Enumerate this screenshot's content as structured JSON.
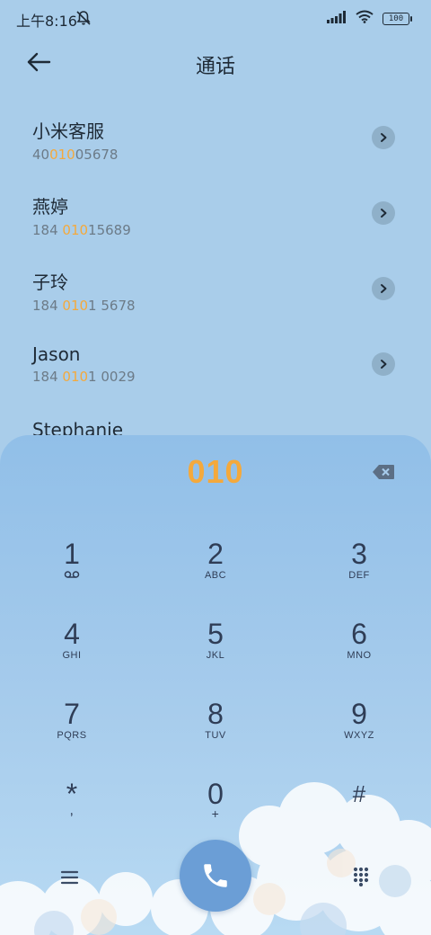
{
  "status": {
    "time": "上午8:16",
    "battery": "100"
  },
  "header": {
    "title": "通话"
  },
  "contacts": [
    {
      "name": "小米客服",
      "num_pre": "40",
      "num_hl": "010",
      "num_post": "05678"
    },
    {
      "name": "燕婷",
      "num_pre": "184 ",
      "num_hl": "010",
      "num_post": "15689"
    },
    {
      "name": "子玲",
      "num_pre": "184 ",
      "num_hl": "010",
      "num_post": "1 5678"
    },
    {
      "name": "Jason",
      "num_pre": "184 ",
      "num_hl": "010",
      "num_post": "1 0029"
    },
    {
      "name": "Stephanie",
      "num_pre": "",
      "num_hl": "",
      "num_post": ""
    }
  ],
  "dialer": {
    "input": "010",
    "keys": [
      {
        "digit": "1",
        "letters": ""
      },
      {
        "digit": "2",
        "letters": "ABC"
      },
      {
        "digit": "3",
        "letters": "DEF"
      },
      {
        "digit": "4",
        "letters": "GHI"
      },
      {
        "digit": "5",
        "letters": "JKL"
      },
      {
        "digit": "6",
        "letters": "MNO"
      },
      {
        "digit": "7",
        "letters": "PQRS"
      },
      {
        "digit": "8",
        "letters": "TUV"
      },
      {
        "digit": "9",
        "letters": "WXYZ"
      },
      {
        "digit": "*",
        "letters": ","
      },
      {
        "digit": "0",
        "letters": "+"
      },
      {
        "digit": "#",
        "letters": ""
      }
    ]
  },
  "colors": {
    "highlight": "#f4a93c",
    "call_button": "#6b9ed6",
    "background": "#a9cdea"
  },
  "icons": [
    "back-arrow-icon",
    "chevron-right-icon",
    "backspace-icon",
    "voicemail-icon",
    "menu-icon",
    "phone-icon",
    "dialpad-icon",
    "signal-icon",
    "wifi-icon",
    "mute-bell-icon"
  ]
}
